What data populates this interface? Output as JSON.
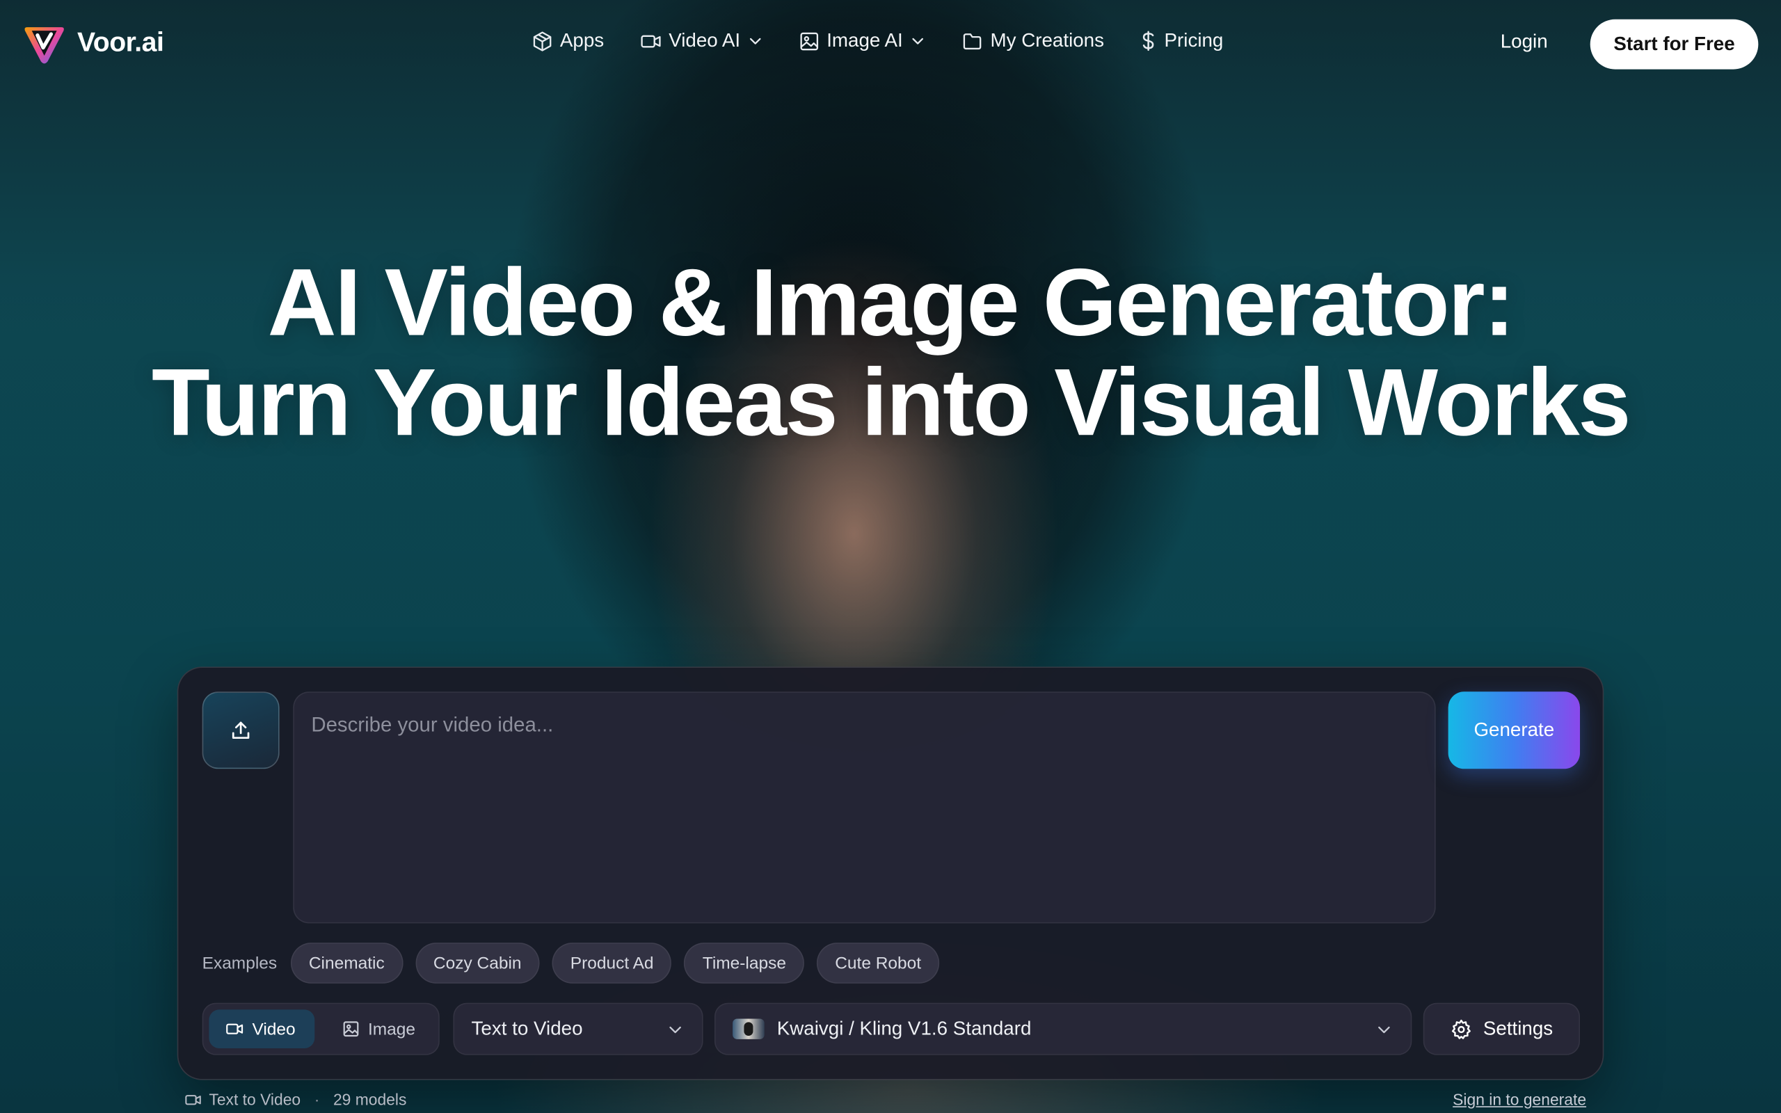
{
  "brand": {
    "name": "Voor.ai",
    "logo_colors": [
      "#f59e0b",
      "#ec4899",
      "#6366f1"
    ]
  },
  "nav": {
    "items": [
      {
        "label": "Apps",
        "icon": "box-icon",
        "dropdown": false
      },
      {
        "label": "Video AI",
        "icon": "video-camera-icon",
        "dropdown": true
      },
      {
        "label": "Image AI",
        "icon": "image-icon",
        "dropdown": true
      },
      {
        "label": "My Creations",
        "icon": "folder-icon",
        "dropdown": false
      },
      {
        "label": "Pricing",
        "icon": "dollar-icon",
        "dropdown": false
      }
    ],
    "login_label": "Login",
    "cta_label": "Start for Free"
  },
  "hero": {
    "line1": "AI Video & Image Generator:",
    "line2": "Turn Your Ideas into Visual Works"
  },
  "generator": {
    "upload_icon": "upload-icon",
    "prompt_placeholder": "Describe your video idea...",
    "prompt_value": "",
    "generate_label": "Generate",
    "generate_gradient": [
      "#16b8e6",
      "#3f7ff0",
      "#8a48ec"
    ],
    "examples_label": "Examples",
    "examples": [
      "Cinematic",
      "Cozy Cabin",
      "Product Ad",
      "Time-lapse",
      "Cute Robot"
    ],
    "modes": [
      {
        "label": "Video",
        "icon": "video-camera-icon",
        "active": true
      },
      {
        "label": "Image",
        "icon": "image-icon",
        "active": false
      }
    ],
    "task_select": "Text to Video",
    "model_select": "Kwaivgi / Kling V1.6 Standard",
    "settings_label": "Settings"
  },
  "footer": {
    "mode_label": "Text to Video",
    "separator": "·",
    "models_count": "29 models",
    "signin_label": "Sign in to generate"
  }
}
